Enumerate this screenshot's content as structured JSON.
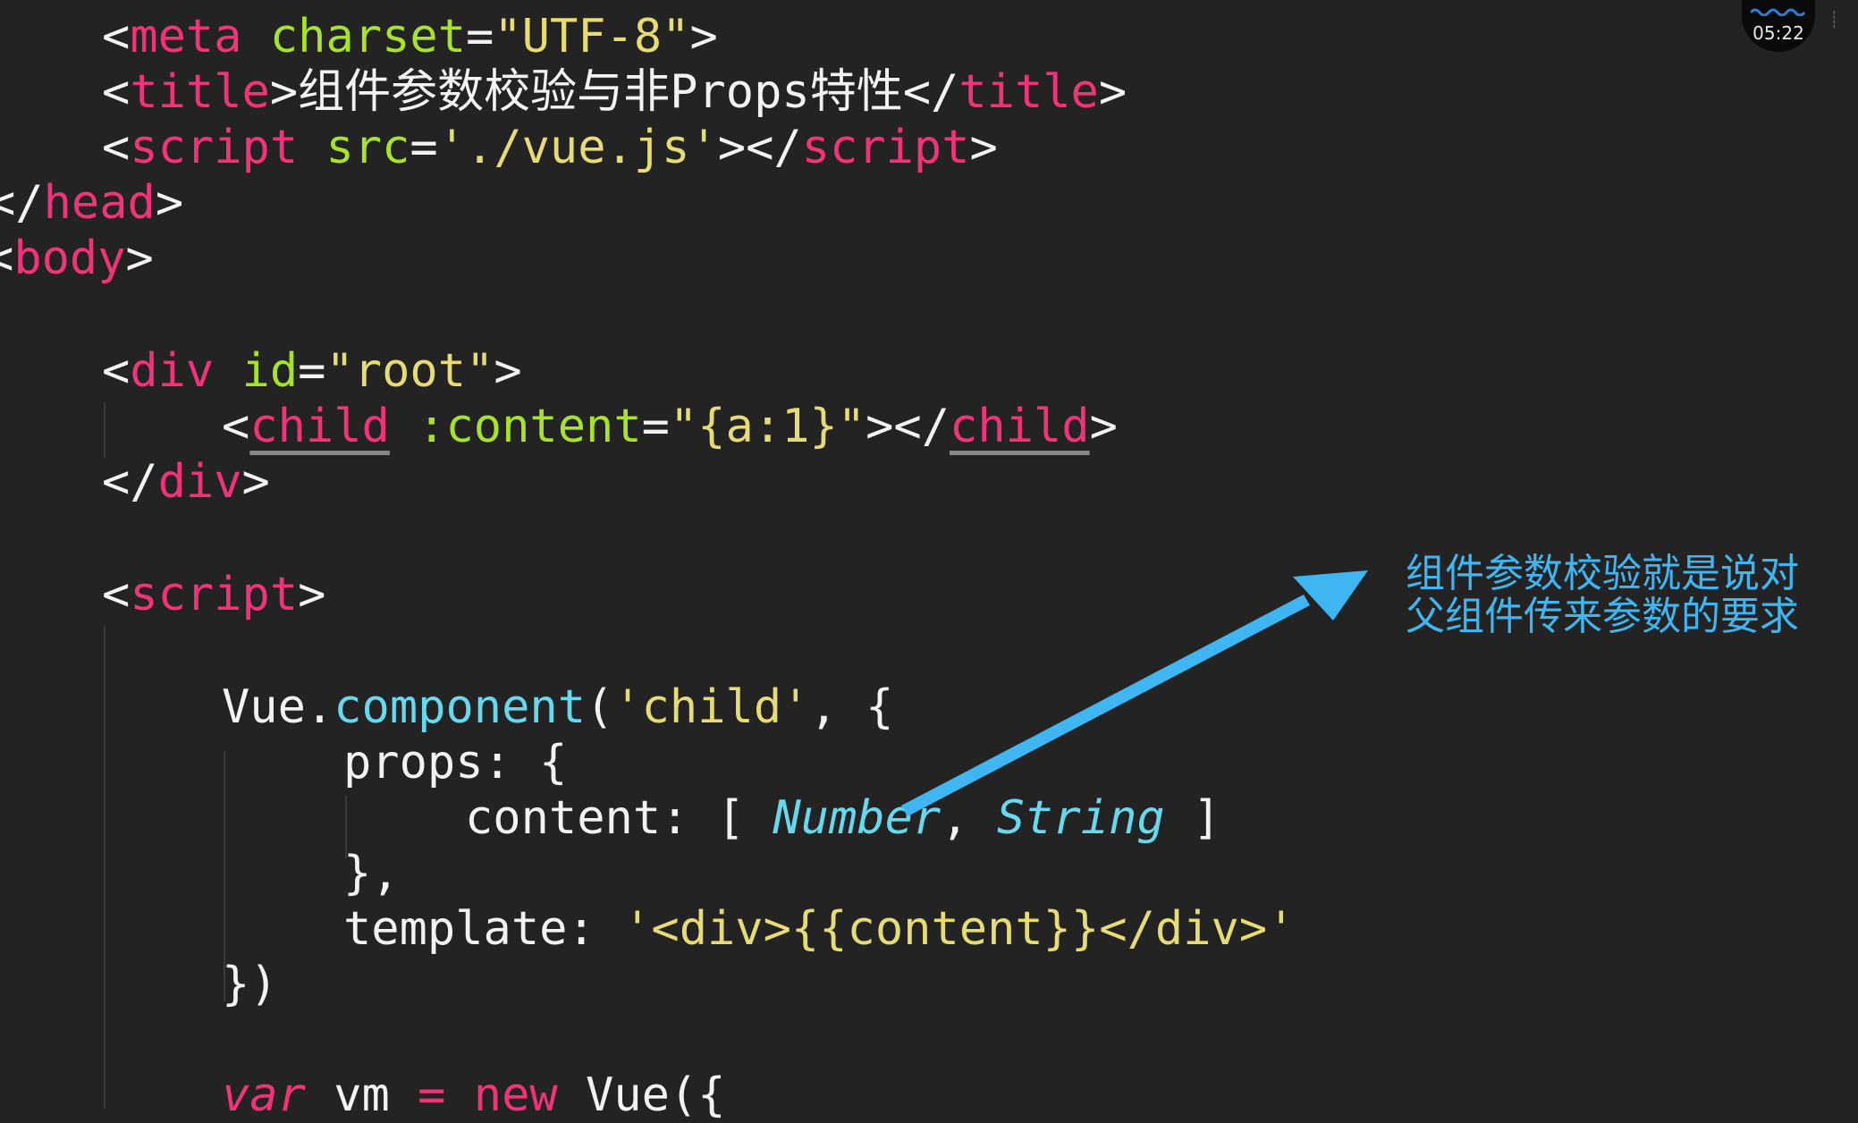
{
  "timer": {
    "time": "05:22"
  },
  "code": {
    "line_meta": [
      "<",
      "meta",
      " ",
      "charset",
      "=",
      "\"UTF-8\"",
      ">"
    ],
    "line_title": [
      "<",
      "title",
      ">组件参数校验与非Props特性</",
      "title",
      ">"
    ],
    "line_script_src": [
      "<",
      "script",
      " ",
      "src",
      "=",
      "'./vue.js'",
      "></",
      "script",
      ">"
    ],
    "line_head_close": [
      "</",
      "head",
      ">"
    ],
    "line_body_open": [
      "<",
      "body",
      ">"
    ],
    "line_div_open": [
      "<",
      "div",
      " ",
      "id",
      "=",
      "\"root\"",
      ">"
    ],
    "line_child": [
      "<",
      "child",
      " ",
      ":content",
      "=",
      "\"{a:1}\"",
      "></",
      "child",
      ">"
    ],
    "line_div_close": [
      "</",
      "div",
      ">"
    ],
    "line_script_open": [
      "<",
      "script",
      ">"
    ],
    "line_component": [
      "Vue.",
      "component",
      "(",
      "'child'",
      ", {"
    ],
    "line_props": [
      "props: {"
    ],
    "line_content_prop": [
      "content: [ ",
      "Number",
      ", ",
      "String",
      " ]"
    ],
    "line_props_close": [
      "},"
    ],
    "line_template": [
      "template: ",
      "'<div>{{content}}</div>'"
    ],
    "line_component_close": [
      "})"
    ],
    "line_vm": [
      "var",
      " vm ",
      "=",
      " ",
      "new",
      " Vue({"
    ]
  },
  "annotation": {
    "text": "组件参数校验就是说对父组件传来参数的要求",
    "color": "#3fb6f2"
  }
}
